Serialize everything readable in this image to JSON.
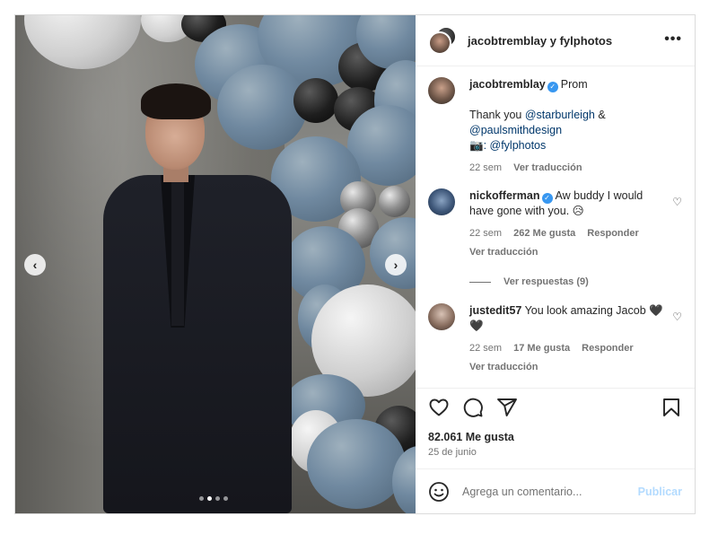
{
  "header": {
    "title": "jacobtremblay y fylphotos",
    "more_icon": "more-horizontal-icon"
  },
  "caption": {
    "username": "jacobtremblay",
    "verified": true,
    "line1": "Prom",
    "thanks_prefix": "Thank you ",
    "mention1": "@starburleigh",
    "amp": " &",
    "mention2": "@paulsmithdesign",
    "camera_emoji": "📷",
    "mention3": ": @fylphotos",
    "time": "22 sem",
    "translate": "Ver traducción"
  },
  "comments": [
    {
      "username": "nickofferman",
      "verified": true,
      "text": "Aw buddy I would have gone with you. 😥",
      "time": "22 sem",
      "likes": "262 Me gusta",
      "reply": "Responder",
      "translate": "Ver traducción",
      "view_replies": "Ver respuestas (9)"
    },
    {
      "username": "justedit57",
      "verified": false,
      "text": "You look amazing Jacob 🖤🖤",
      "time": "22 sem",
      "likes": "17 Me gusta",
      "reply": "Responder",
      "translate": "Ver traducción"
    }
  ],
  "actions": {
    "icons": [
      "heart-icon",
      "comment-icon",
      "share-icon",
      "bookmark-icon"
    ]
  },
  "likes": "82.061 Me gusta",
  "date": "25 de junio",
  "compose": {
    "placeholder": "Agrega un comentario...",
    "publish": "Publicar"
  },
  "carousel": {
    "dot_count": 4,
    "active_index": 1
  },
  "colors": {
    "link": "#00376b",
    "verified": "#3897f0",
    "publish_disabled": "#b3dbff",
    "muted": "#737373"
  }
}
